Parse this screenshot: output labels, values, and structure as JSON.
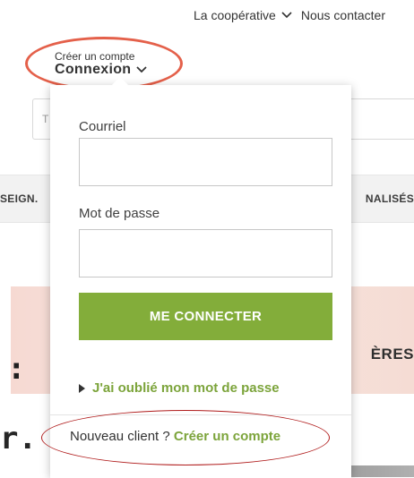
{
  "top_nav": {
    "items": [
      {
        "label": "La coopérative",
        "has_dropdown": true
      },
      {
        "label": "Nous contacter",
        "has_dropdown": false
      }
    ]
  },
  "account": {
    "small_label": "Créer un compte",
    "main_label": "Connexion"
  },
  "background": {
    "search_placeholder": "T",
    "category_left": "SEIGN.",
    "category_right": "NALISÉS",
    "hero_right_text": "ÈRES",
    "hero_left_mark": ":",
    "hero_bottom_text": "r."
  },
  "login_form": {
    "email_label": "Courriel",
    "email_value": "",
    "password_label": "Mot de passe",
    "password_value": "",
    "submit_label": "ME CONNECTER",
    "forgot_link": "J'ai oublié mon mot de passe",
    "new_client_text": "Nouveau client ?",
    "create_account_link": "Créer un compte"
  },
  "colors": {
    "accent_green": "#83ad3a",
    "link_green": "#7ca43b",
    "highlight_orange": "#e4604a",
    "highlight_red": "#b01c1c"
  }
}
